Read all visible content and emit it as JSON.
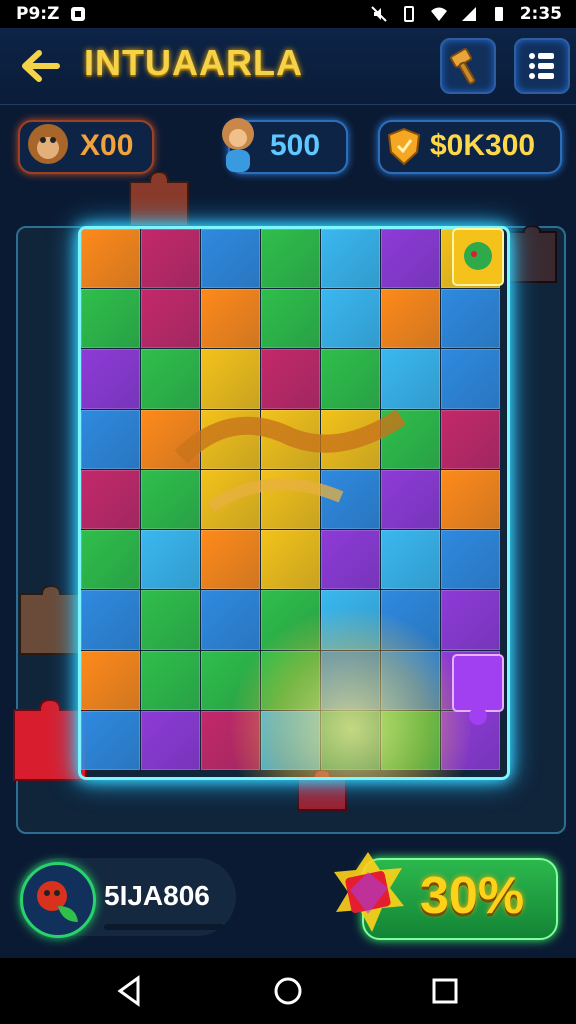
{
  "status_bar": {
    "time_left": "P9:Z",
    "time_right": "2:35"
  },
  "header": {
    "title": "INTUAARLA"
  },
  "currencies": [
    {
      "value": "X00",
      "icon": "monkey-face-icon",
      "color": "#f2a23a"
    },
    {
      "value": "500",
      "icon": "monkey-character-icon",
      "color": "#5ec8ff"
    },
    {
      "value": "$0K300",
      "icon": "gold-shield-icon",
      "color": "#ffd84a"
    }
  ],
  "board": {
    "rows": 9,
    "cols": 7,
    "palette": [
      "#ff8a1a",
      "#c4286a",
      "#2f8ae0",
      "#2fbf4a",
      "#3ab8f0",
      "#8f3ad8",
      "#f4c21a",
      "#1a9a6a"
    ]
  },
  "player": {
    "code": "5IJA806",
    "avatar_icon": "red-fruit-leaf-icon"
  },
  "progress": {
    "value": "30%",
    "icon": "red-gem-icon"
  },
  "nav": {
    "back": "back-triangle-icon",
    "home": "home-circle-icon",
    "recents": "recents-square-icon"
  }
}
